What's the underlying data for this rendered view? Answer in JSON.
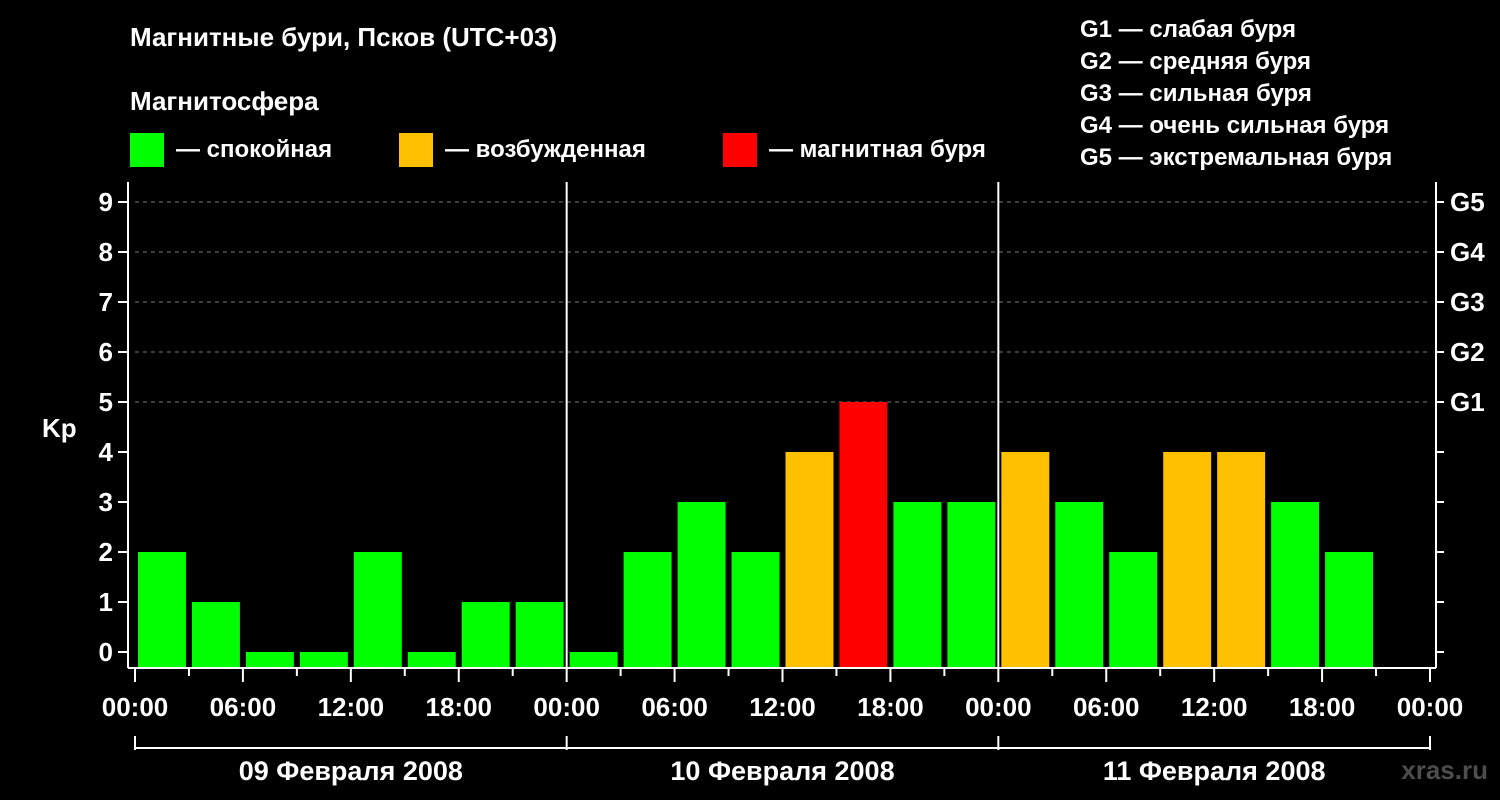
{
  "header": {
    "title": "Магнитные бури, Псков (UTC+03)",
    "legend_title": "Магнитосфера"
  },
  "legend": [
    {
      "label": "— спокойная",
      "color": "#00ff00"
    },
    {
      "label": "— возбужденная",
      "color": "#ffc000"
    },
    {
      "label": "— магнитная буря",
      "color": "#ff0000"
    }
  ],
  "storm_scale": [
    "G1 — слабая буря",
    "G2 — средняя буря",
    "G3 — сильная буря",
    "G4 — очень сильная буря",
    "G5 — экстремальная буря"
  ],
  "watermark": "xras.ru",
  "chart_data": {
    "type": "bar",
    "title": "Магнитные бури, Псков (UTC+03)",
    "ylabel": "Kp",
    "ylim": [
      0,
      9
    ],
    "yticks": [
      "0",
      "1",
      "2",
      "3",
      "4",
      "5",
      "6",
      "7",
      "8",
      "9"
    ],
    "right_axis": [
      {
        "kp": 5,
        "label": "G1"
      },
      {
        "kp": 6,
        "label": "G2"
      },
      {
        "kp": 7,
        "label": "G3"
      },
      {
        "kp": 8,
        "label": "G4"
      },
      {
        "kp": 9,
        "label": "G5"
      }
    ],
    "xtick_labels": [
      "00:00",
      "06:00",
      "12:00",
      "18:00",
      "00:00",
      "06:00",
      "12:00",
      "18:00",
      "00:00",
      "06:00",
      "12:00",
      "18:00",
      "00:00"
    ],
    "days": [
      "09 Февраля 2008",
      "10 Февраля 2008",
      "11 Февраля 2008"
    ],
    "interval_hours": 3,
    "values": [
      2,
      1,
      0,
      0,
      2,
      0,
      1,
      1,
      0,
      2,
      3,
      2,
      4,
      5,
      3,
      3,
      4,
      3,
      2,
      4,
      4,
      3,
      2
    ],
    "levels": [
      "quiet",
      "quiet",
      "quiet",
      "quiet",
      "quiet",
      "quiet",
      "quiet",
      "quiet",
      "quiet",
      "quiet",
      "quiet",
      "quiet",
      "active",
      "storm",
      "quiet",
      "quiet",
      "active",
      "quiet",
      "quiet",
      "active",
      "active",
      "quiet",
      "quiet"
    ],
    "level_colors": {
      "quiet": "#00ff00",
      "active": "#ffc000",
      "storm": "#ff0000"
    },
    "grid": "dashed at integer Kp 5–9"
  }
}
